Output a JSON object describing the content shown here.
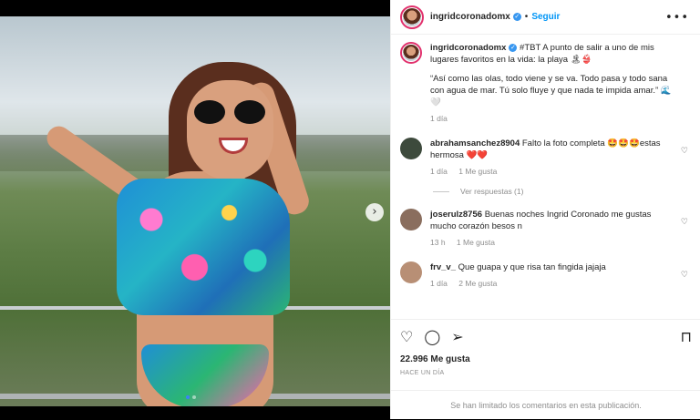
{
  "header": {
    "username": "ingridcoronadomx",
    "separator": "•",
    "follow_label": "Seguir",
    "more": "•••"
  },
  "caption": {
    "username": "ingridcoronadomx",
    "text": "#TBT A punto de salir a uno de mis lugares favoritos en la vida: la playa 🏝👙",
    "quote": "“Así como las olas, todo viene y se va. Todo pasa y todo sana con agua de mar. Tú solo fluye y que nada te impida amar.” 🌊🤍",
    "time": "1 día"
  },
  "comments": [
    {
      "username": "abrahamsanchez8904",
      "text": "Falto la foto completa 🤩🤩🤩estas hermosa ❤️❤️",
      "time": "1 día",
      "likes": "1 Me gusta",
      "replies": "Ver respuestas (1)",
      "avatar_color": "#3d4a3c"
    },
    {
      "username": "joserulz8756",
      "text": "Buenas noches Ingrid Coronado me gustas mucho corazón besos n",
      "time": "13 h",
      "likes": "1 Me gusta",
      "avatar_color": "#8a6e5e"
    },
    {
      "username": "frv_v_",
      "text": "Que guapa y que risa tan fingida jajaja",
      "time": "1 día",
      "likes": "2 Me gusta",
      "avatar_color": "#b88f75"
    }
  ],
  "actions": {
    "like_icon": "♡",
    "comment_icon": "◯",
    "share_icon": "➢",
    "save_icon": "⊓",
    "likes_count": "22.996 Me gusta",
    "posted_ago": "HACE UN DÍA"
  },
  "footer": {
    "limited": "Se han limitado los comentarios en esta publicación."
  },
  "media": {
    "next_arrow": "›",
    "carousel_slides": 2,
    "active_slide": 1
  },
  "colors": {
    "verified": "#3897f0",
    "follow": "#0095f6",
    "story_ring": "#e1306c"
  }
}
